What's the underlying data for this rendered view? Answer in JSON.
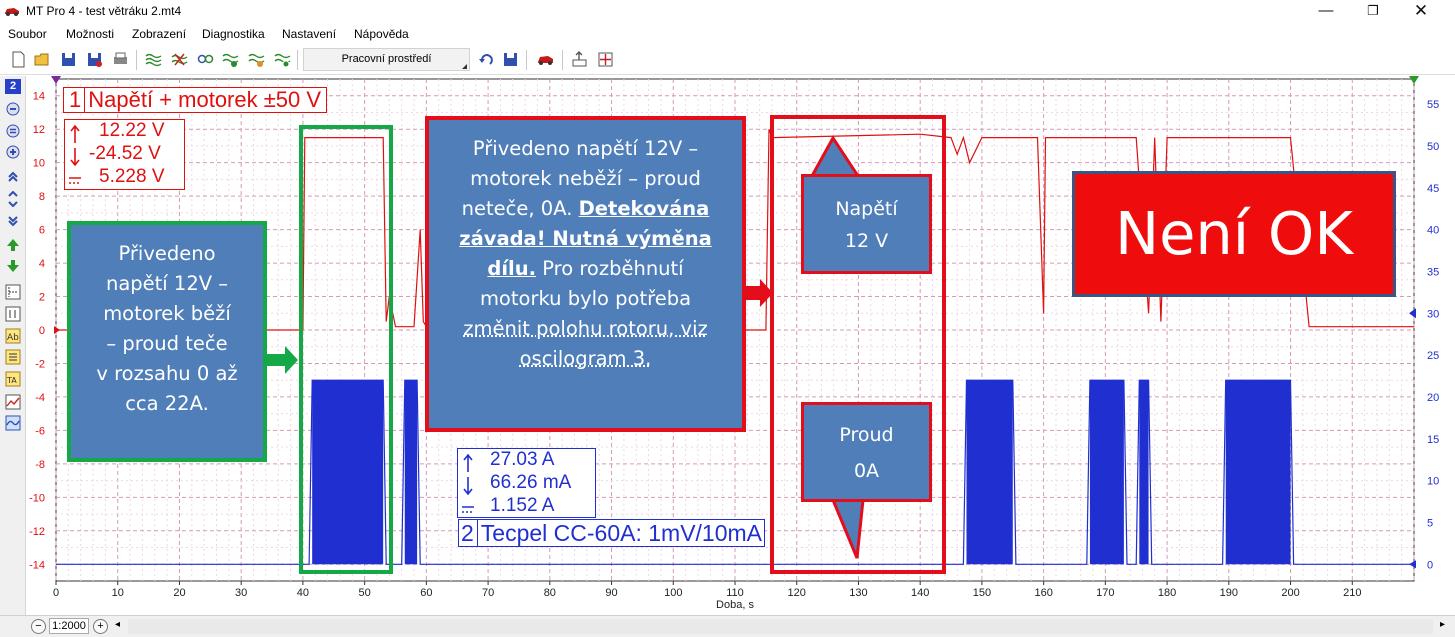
{
  "window": {
    "title": "MT Pro 4 - test větráku 2.mt4",
    "min": "—",
    "max": "❐",
    "close": "✕"
  },
  "menu": [
    "Soubor",
    "Možnosti",
    "Zobrazení",
    "Diagnostika",
    "Nastavení",
    "Nápověda"
  ],
  "toolbar": {
    "workspace": "Pracovní prostředí"
  },
  "channel_selector": "2",
  "colors": {
    "ch1": "#e01010",
    "ch2": "#2030d0",
    "callout_fill": "#4f7eb8",
    "callout_green": "#15a846",
    "callout_red": "#e30e19",
    "not_ok": "#ef0c0c"
  },
  "chart_data": {
    "type": "line",
    "xlabel": "Doba, s",
    "xlim": [
      0,
      220
    ],
    "x_ticks": [
      0,
      10,
      20,
      30,
      40,
      50,
      60,
      70,
      80,
      90,
      100,
      110,
      120,
      130,
      140,
      150,
      160,
      170,
      180,
      190,
      200,
      210
    ],
    "ylim_left": [
      -15,
      15
    ],
    "y_ticks_left": [
      14,
      12,
      10,
      8,
      6,
      4,
      2,
      0,
      -2,
      -4,
      -6,
      -8,
      -10,
      -12,
      -14
    ],
    "ylim_right": [
      -2,
      58
    ],
    "y_ticks_right": [
      55,
      50,
      45,
      40,
      35,
      30,
      25,
      20,
      15,
      10,
      5,
      0
    ],
    "grid": true,
    "series": [
      {
        "name": "Napětí + motorek ±50 V",
        "axis": "left",
        "x": [
          0,
          40,
          40.3,
          41,
          53,
          53.5,
          54,
          55,
          58,
          59,
          59.5,
          60,
          62,
          63,
          75,
          98,
          115,
          115.5,
          116,
          140,
          145,
          146,
          147,
          148,
          150,
          159,
          160,
          160.3,
          161,
          170,
          175,
          177,
          178,
          179,
          180,
          183,
          200,
          203,
          220
        ],
        "y": [
          0,
          0,
          11.5,
          11.5,
          11.5,
          0.5,
          2,
          0.2,
          0.2,
          6,
          0.5,
          0.2,
          0.2,
          0.2,
          0,
          0,
          0,
          12,
          11.5,
          11.7,
          11.5,
          10.5,
          11.5,
          10,
          11.5,
          11.5,
          1,
          11.5,
          11.5,
          11.5,
          11.5,
          1,
          11.5,
          0.5,
          11.5,
          11.5,
          11.5,
          0.2,
          0.2
        ]
      },
      {
        "name": "Tecpel CC-60A: 1mV/10mA",
        "axis": "right",
        "x": [
          0,
          41,
          41.5,
          53,
          53.5,
          56,
          56.5,
          58.5,
          59,
          145,
          146,
          147,
          147.5,
          155,
          155.5,
          167,
          167.5,
          173,
          173.5,
          175,
          175.5,
          177,
          177.5,
          189,
          189.5,
          200,
          200.5,
          220
        ],
        "y": [
          0,
          0,
          22,
          22,
          0,
          0,
          22,
          22,
          0,
          0,
          0,
          0,
          22,
          22,
          0,
          0,
          22,
          22,
          0,
          0,
          22,
          22,
          0,
          0,
          22,
          22,
          0,
          0
        ]
      }
    ]
  },
  "ch1": {
    "num": "1",
    "title": "Napětí + motorek  ±50 V",
    "max": "12.22 V",
    "min": "-24.52 V",
    "avg": "5.228 V"
  },
  "ch2": {
    "num": "2",
    "title": "Tecpel CC-60A: 1mV/10mA",
    "max": "27.03 A",
    "min": "66.26 mA",
    "avg": "1.152 A"
  },
  "annotations": {
    "green_box": [
      "Přivedeno",
      "napětí 12V –",
      "motorek běží",
      "– proud teče",
      "v rozsahu 0 až",
      "cca 22A."
    ],
    "red_box": {
      "line1": "Přivedeno napětí 12V –",
      "line2": "motorek neběží – proud",
      "line3_plain": "neteče, 0A. ",
      "line3_bold": "Detekována",
      "line4_bold": "závada! Nutná výměna",
      "line5_bold": "dílu.",
      "line5_plain": " Pro rozběhnutí",
      "line6": "motorku bylo potřeba",
      "line7": "změnit polohu rotoru, viz",
      "line8": "oscilogram 3."
    },
    "napeti": [
      "Napětí",
      "12 V"
    ],
    "proud": [
      "Proud",
      "0A"
    ],
    "not_ok": "Není OK"
  },
  "statusbar": {
    "zoom_out": "−",
    "zoom": "1:2000",
    "zoom_in": "+",
    "left": "◂",
    "right": "▸"
  }
}
